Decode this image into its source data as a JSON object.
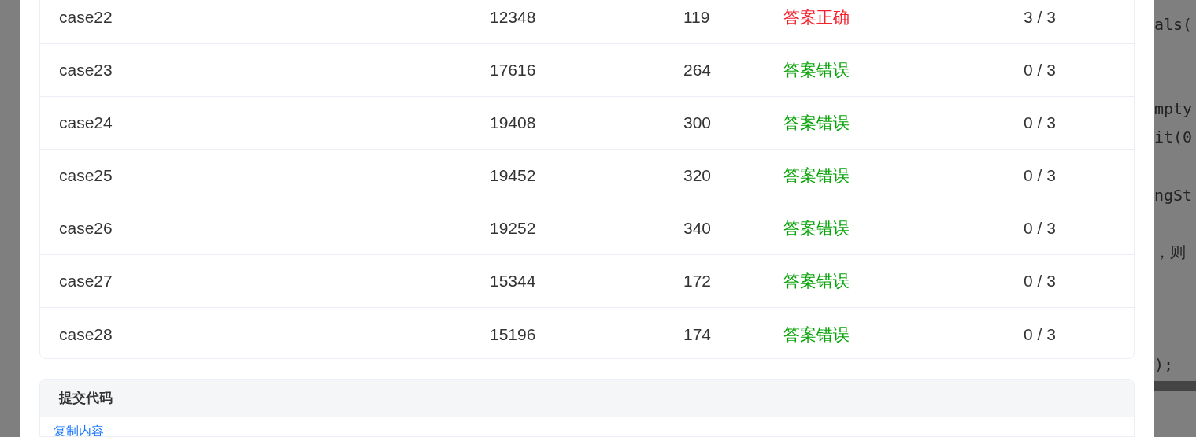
{
  "results": {
    "rows": [
      {
        "case": "case22",
        "col2": "12348",
        "col3": "119",
        "status": "答案正确",
        "color": "#f5222d",
        "score": "3 / 3"
      },
      {
        "case": "case23",
        "col2": "17616",
        "col3": "264",
        "status": "答案错误",
        "color": "#0aa30a",
        "score": "0 / 3"
      },
      {
        "case": "case24",
        "col2": "19408",
        "col3": "300",
        "status": "答案错误",
        "color": "#0aa30a",
        "score": "0 / 3"
      },
      {
        "case": "case25",
        "col2": "19452",
        "col3": "320",
        "status": "答案错误",
        "color": "#0aa30a",
        "score": "0 / 3"
      },
      {
        "case": "case26",
        "col2": "19252",
        "col3": "340",
        "status": "答案错误",
        "color": "#0aa30a",
        "score": "0 / 3"
      },
      {
        "case": "case27",
        "col2": "15344",
        "col3": "172",
        "status": "答案错误",
        "color": "#0aa30a",
        "score": "0 / 3"
      },
      {
        "case": "case28",
        "col2": "15196",
        "col3": "174",
        "status": "答案错误",
        "color": "#0aa30a",
        "score": "0 / 3"
      }
    ]
  },
  "submitted_code": {
    "title": "提交代码",
    "copy_link": "复制内容"
  },
  "background_code": {
    "lines": [
      "als(",
      "mpty",
      "it(0",
      "ngSt",
      "，则",
      ");"
    ]
  }
}
